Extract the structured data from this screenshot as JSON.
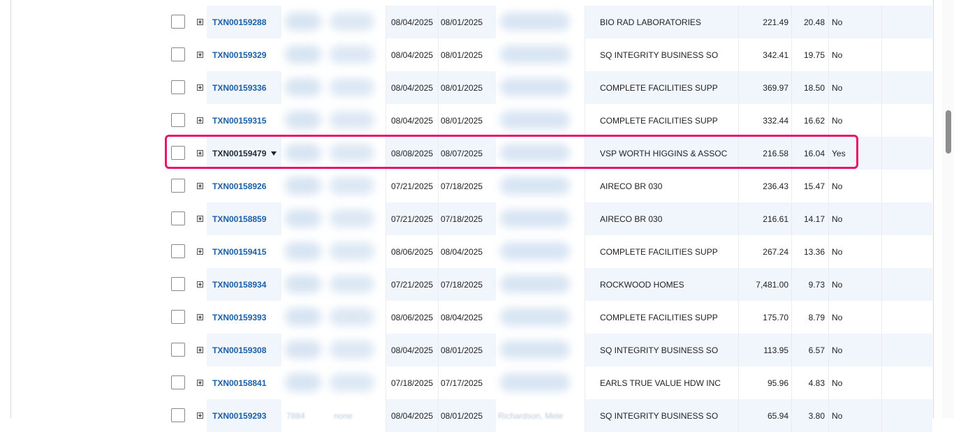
{
  "rows": [
    {
      "txn": "TXN00159288",
      "d1": "08/04/2025",
      "d2": "08/01/2025",
      "vendor": "BIO RAD LABORATORIES",
      "amount": "221.49",
      "pct": "20.48",
      "flag": "No"
    },
    {
      "txn": "TXN00159329",
      "d1": "08/04/2025",
      "d2": "08/01/2025",
      "vendor": "SQ INTEGRITY BUSINESS SO",
      "amount": "342.41",
      "pct": "19.75",
      "flag": "No"
    },
    {
      "txn": "TXN00159336",
      "d1": "08/04/2025",
      "d2": "08/01/2025",
      "vendor": "COMPLETE FACILITIES SUPP",
      "amount": "369.97",
      "pct": "18.50",
      "flag": "No"
    },
    {
      "txn": "TXN00159315",
      "d1": "08/04/2025",
      "d2": "08/01/2025",
      "vendor": "COMPLETE FACILITIES SUPP",
      "amount": "332.44",
      "pct": "16.62",
      "flag": "No"
    },
    {
      "txn": "TXN00159479",
      "d1": "08/08/2025",
      "d2": "08/07/2025",
      "vendor": "VSP WORTH HIGGINS & ASSOC",
      "amount": "216.58",
      "pct": "16.04",
      "flag": "Yes"
    },
    {
      "txn": "TXN00158926",
      "d1": "07/21/2025",
      "d2": "07/18/2025",
      "vendor": "AIRECO BR 030",
      "amount": "236.43",
      "pct": "15.47",
      "flag": "No"
    },
    {
      "txn": "TXN00158859",
      "d1": "07/21/2025",
      "d2": "07/18/2025",
      "vendor": "AIRECO BR 030",
      "amount": "216.61",
      "pct": "14.17",
      "flag": "No"
    },
    {
      "txn": "TXN00159415",
      "d1": "08/06/2025",
      "d2": "08/04/2025",
      "vendor": "COMPLETE FACILITIES SUPP",
      "amount": "267.24",
      "pct": "13.36",
      "flag": "No"
    },
    {
      "txn": "TXN00158934",
      "d1": "07/21/2025",
      "d2": "07/18/2025",
      "vendor": "ROCKWOOD HOMES",
      "amount": "7,481.00",
      "pct": "9.73",
      "flag": "No"
    },
    {
      "txn": "TXN00159393",
      "d1": "08/06/2025",
      "d2": "08/04/2025",
      "vendor": "COMPLETE FACILITIES SUPP",
      "amount": "175.70",
      "pct": "8.79",
      "flag": "No"
    },
    {
      "txn": "TXN00159308",
      "d1": "08/04/2025",
      "d2": "08/01/2025",
      "vendor": "SQ INTEGRITY BUSINESS SO",
      "amount": "113.95",
      "pct": "6.57",
      "flag": "No"
    },
    {
      "txn": "TXN00158841",
      "d1": "07/18/2025",
      "d2": "07/17/2025",
      "vendor": "EARLS TRUE VALUE HDW INC",
      "amount": "95.96",
      "pct": "4.83",
      "flag": "No"
    },
    {
      "txn": "TXN00159293",
      "d1": "08/04/2025",
      "d2": "08/01/2025",
      "vendor": "SQ INTEGRITY BUSINESS SO",
      "amount": "65.94",
      "pct": "3.80",
      "flag": "No",
      "faint": [
        "7884",
        "none",
        "Richardson, Mele"
      ]
    }
  ],
  "active_row": "TXN00159479",
  "colors": {
    "link": "#1a5fa8",
    "highlight": "#e8156a",
    "row_alt": "#f1f6fc"
  }
}
